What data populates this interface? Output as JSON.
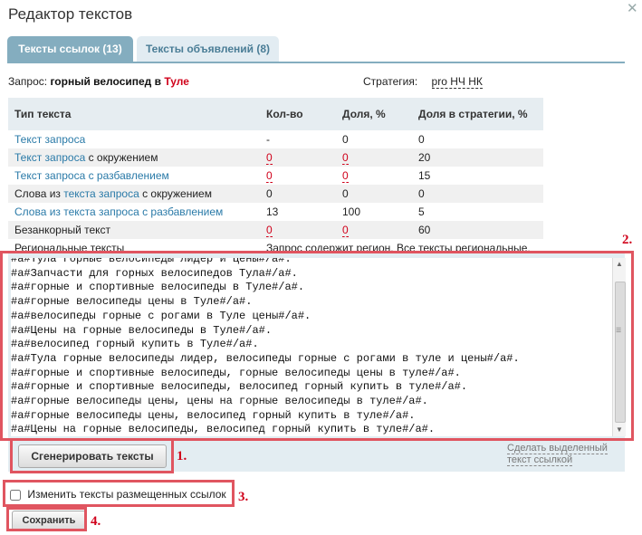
{
  "dialog": {
    "title": "Редактор текстов"
  },
  "tabs": [
    {
      "label": "Тексты ссылок (13)"
    },
    {
      "label": "Тексты объявлений (8)"
    }
  ],
  "query": {
    "label": "Запрос:",
    "text": "горный велосипед в",
    "city": "Туле"
  },
  "strategy": {
    "label": "Стратегия:",
    "value": "pro НЧ НК"
  },
  "table": {
    "headers": [
      "Тип текста",
      "Кол-во",
      "Доля, %",
      "Доля в стратегии, %"
    ],
    "rows": [
      {
        "type_link": "Текст запроса",
        "type_rest": "",
        "count": "-",
        "share": "0",
        "strategy_share": "0"
      },
      {
        "type_link": "Текст запроса",
        "type_rest": " с окружением",
        "count": "0",
        "share": "0",
        "strategy_share": "20"
      },
      {
        "type_link": "Текст запроса с разбавлением",
        "type_rest": "",
        "count": "0",
        "share": "0",
        "strategy_share": "15"
      },
      {
        "type_pre": "Слова из ",
        "type_link": "текста запроса",
        "type_rest": " с окружением",
        "count": "0",
        "share": "0",
        "strategy_share": "0"
      },
      {
        "type_link": "Слова из текста запроса с разбавлением",
        "type_rest": "",
        "count": "13",
        "share": "100",
        "strategy_share": "5"
      },
      {
        "type_plain": "Безанкорный текст",
        "count": "0",
        "share": "0",
        "strategy_share": "60"
      }
    ],
    "regional_label": "Региональные тексты",
    "regional_note": "Запрос содержит регион. Все тексты региональные."
  },
  "editor": {
    "lines": [
      "#a#Тула горные велосипеды лидер и цены#/a#.",
      "#a#Запчасти для горных велосипедов Тула#/a#.",
      "#a#горные и спортивные велосипеды в Туле#/a#.",
      "#a#горные велосипеды цены в Туле#/a#.",
      "#a#велосипеды горные с рогами в Туле цены#/a#.",
      "#a#Цены на горные велосипеды в Туле#/a#.",
      "#a#велосипед горный купить в Туле#/a#.",
      "#a#Тула горные велосипеды лидер, велосипеды горные с рогами в туле и цены#/a#.",
      "#a#горные и спортивные велосипеды, горные велосипеды цены в туле#/a#.",
      "#a#горные и спортивные велосипеды, велосипед горный купить в туле#/a#.",
      "#a#горные велосипеды цены, цены на горные велосипеды в туле#/a#.",
      "#a#горные велосипеды цены, велосипед горный купить в туле#/a#.",
      "#a#Цены на горные велосипеды, велосипед горный купить в туле#/a#."
    ]
  },
  "actions": {
    "generate_label": "Сгенерировать тексты",
    "make_selected_line1": "Сделать выделенный",
    "make_selected_line2": "текст ссылкой",
    "change_placed_label": "Изменить тексты размещенных ссылок",
    "save_label": "Сохранить"
  },
  "annotations": [
    "1.",
    "2.",
    "3.",
    "4."
  ],
  "colors": {
    "accent": "#84adbf",
    "link": "#2a7aa8",
    "highlight": "#e05560",
    "red_text": "#d0021b"
  }
}
